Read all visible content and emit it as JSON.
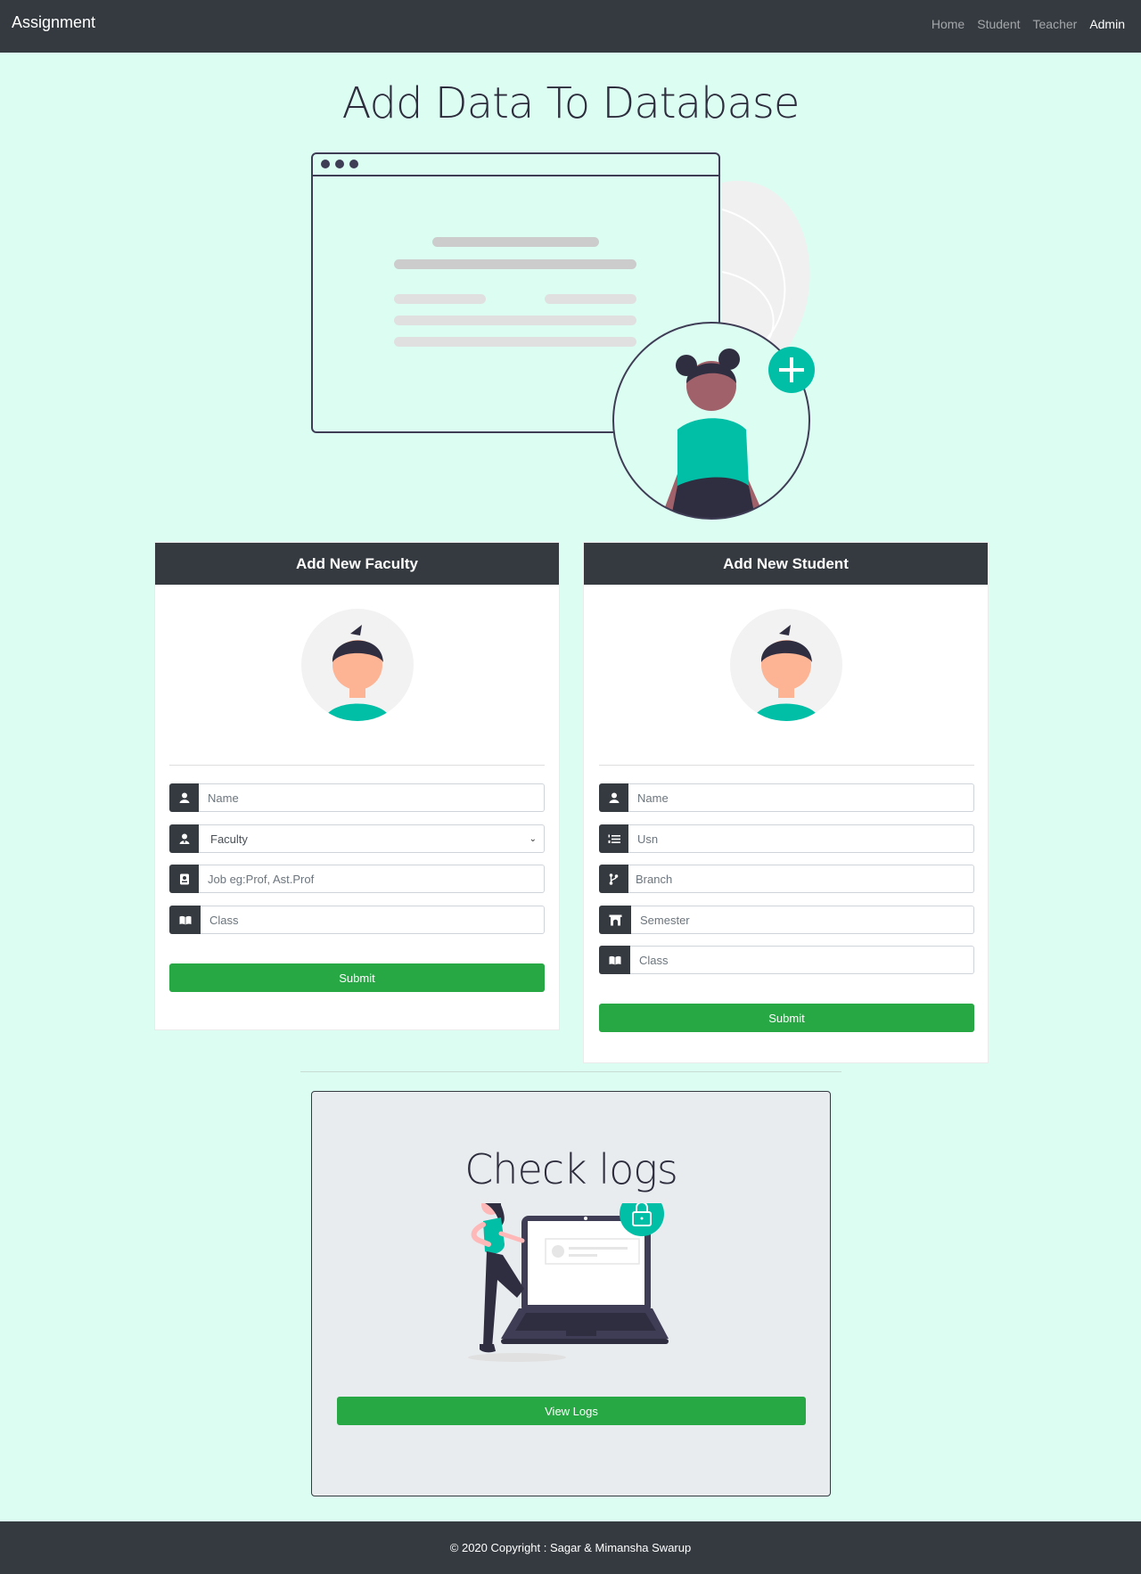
{
  "navbar": {
    "brand": "Assignment",
    "links": [
      "Home",
      "Student",
      "Teacher",
      "Admin"
    ]
  },
  "page_title": "Add Data To Database",
  "faculty_form": {
    "header": "Add New Faculty",
    "name_placeholder": "Name",
    "type_select_value": "Faculty",
    "job_placeholder": "Job eg:Prof, Ast.Prof",
    "class_placeholder": "Class",
    "submit_label": "Submit"
  },
  "student_form": {
    "header": "Add New Student",
    "name_placeholder": "Name",
    "usn_placeholder": "Usn",
    "branch_placeholder": "Branch",
    "semester_placeholder": "Semester",
    "class_placeholder": "Class",
    "submit_label": "Submit"
  },
  "logs": {
    "title": "Check logs",
    "button_label": "View Logs"
  },
  "footer": {
    "text": "© 2020 Copyright : Sagar & Mimansha Swarup"
  },
  "colors": {
    "accent": "#00bfa6",
    "dark": "#343a40",
    "success": "#28a745",
    "background": "#dcfdf1"
  }
}
